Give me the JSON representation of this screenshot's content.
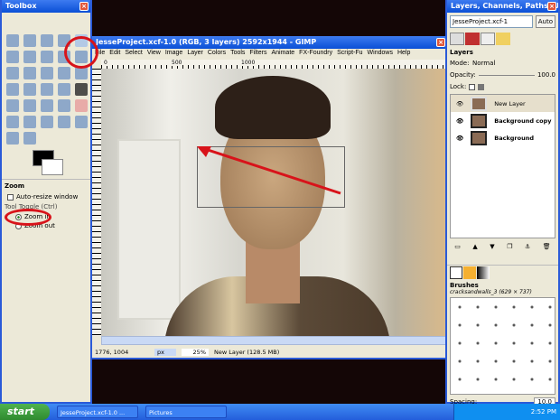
{
  "toolbox": {
    "title": "Toolbox",
    "panel_title": "Zoom",
    "auto_resize": "Auto-resize window",
    "toggle_label": "Tool Toggle (Ctrl)",
    "options": [
      "Zoom in",
      "Zoom out"
    ],
    "selected": "Zoom in"
  },
  "image_window": {
    "title": "JesseProject.xcf-1.0 (RGB, 3 layers) 2592x1944 - GIMP",
    "menu": [
      "File",
      "Edit",
      "Select",
      "View",
      "Image",
      "Layer",
      "Colors",
      "Tools",
      "Filters",
      "Animate",
      "FX-Foundry",
      "Script-Fu",
      "Windows",
      "Help"
    ],
    "ruler_marks": [
      "0",
      "500",
      "1000"
    ],
    "status": {
      "coords": "1776, 1004",
      "unit": "px",
      "zoom": "25%",
      "layer_info": "New Layer (128.5 MB)"
    }
  },
  "dock": {
    "title": "Layers, Channels, Paths, Undo",
    "image_select": "JesseProject.xcf-1",
    "auto_label": "Auto",
    "layers_title": "Layers",
    "mode_label": "Mode:",
    "mode_value": "Normal",
    "opacity_label": "Opacity:",
    "opacity_value": "100.0",
    "opacity": 100,
    "lock_label": "Lock:",
    "layers": [
      {
        "name": "New Layer",
        "selected": true
      },
      {
        "name": "Background copy",
        "selected": false
      },
      {
        "name": "Background",
        "selected": false
      }
    ],
    "brushes_title": "Brushes",
    "brush_name": "cracksandwalls_3 (629 × 737)",
    "spacing_label": "Spacing:",
    "spacing_value": "10.0"
  },
  "taskbar": {
    "start": "start",
    "tasks": [
      "JesseProject.xcf-1.0 ...",
      "Pictures"
    ],
    "clock": "2:52 PM"
  },
  "colors": {
    "titlebar": "#0a4fd6",
    "annotation": "#d8131a",
    "window_bg": "#ece9d8"
  }
}
